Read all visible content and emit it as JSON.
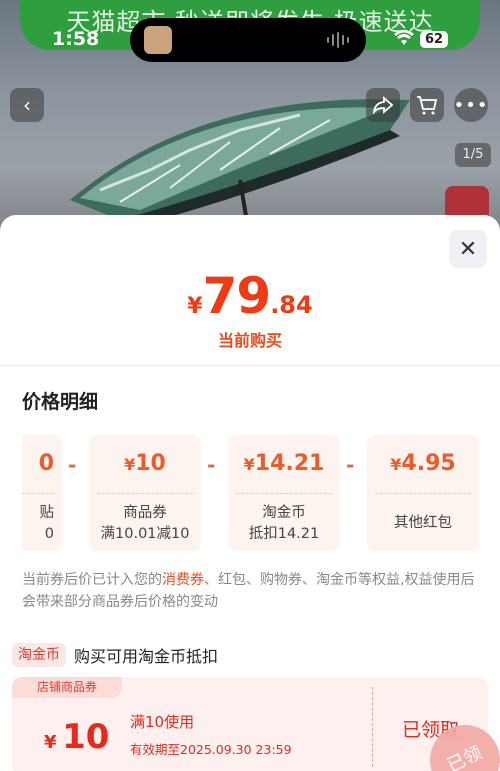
{
  "status_bar": {
    "time": "1:58",
    "battery": "62"
  },
  "banner": {
    "text": "天猫超市  秒送即将发生  极速送达"
  },
  "gallery": {
    "page_indicator": "1/5"
  },
  "sheet": {
    "price": {
      "currency": "¥",
      "integer": "79",
      "decimal": ".84"
    },
    "price_label": "当前购买",
    "section_title": "价格明细",
    "breakdown": [
      {
        "amount": "0",
        "label_line1": "贴",
        "label_line2": "0"
      },
      {
        "amount": "10",
        "currency": "¥",
        "label_line1": "商品券",
        "label_line2": "满10.01减10"
      },
      {
        "amount": "14.21",
        "currency": "¥",
        "label_line1": "淘金币",
        "label_line2": "抵扣14.21"
      },
      {
        "amount": "4.95",
        "currency": "¥",
        "label_line1": "其他红包",
        "label_line2": ""
      }
    ],
    "minus_sign": "-",
    "note": {
      "part1": "当前券后价已计入您的",
      "highlight": "消费券",
      "part2": "、红包、购物券、淘金币等权益,权益使用后会带来部分商品券后价格的变动"
    },
    "coin": {
      "tag": "淘金币",
      "text": "购买可用淘金币抵扣"
    },
    "coupon": {
      "tag": "店铺商品券",
      "currency": "¥",
      "amount": "10",
      "condition": "满10使用",
      "expiry": "有效期至2025.09.30 23:59",
      "status": "已领取",
      "stamp": "已领"
    }
  },
  "colors": {
    "accent": "#f03a14",
    "card_bg": "#fdf3ef",
    "coupon_bg": "#fdf0ef",
    "banner": "#2f9e3e"
  }
}
